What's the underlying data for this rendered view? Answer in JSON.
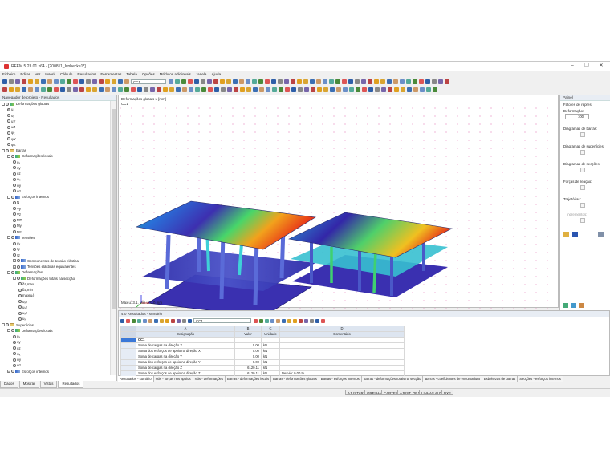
{
  "window": {
    "title": "RFEM 5.23.01 x64 - [200811_Ivobecke1*]",
    "controls": [
      "–",
      "❐",
      "✕"
    ]
  },
  "menu": [
    "Ficheiro",
    "Editar",
    "Ver",
    "Inserir",
    "Cálculo",
    "Resultados",
    "Ferramentas",
    "Tabela",
    "Opções",
    "Módulos adicionais",
    "Janela",
    "Ajuda"
  ],
  "toolbar": {
    "load_case": "CC1",
    "combo2": "",
    "icon_colors": [
      "#2e5fa8",
      "#d9a531",
      "#4a8a3a",
      "#b44",
      "#6b8fc8",
      "#888",
      "#3c6fb3",
      "#d55",
      "#e0a020",
      "#5a9",
      "#7766aa",
      "#c96"
    ]
  },
  "navigator": {
    "title": "Navegador de projeto - Resultados",
    "items": [
      {
        "level": 0,
        "exp": "-",
        "type": "check",
        "icon": "grn",
        "label": "Deformações globais"
      },
      {
        "level": 1,
        "type": "radio",
        "selected": true,
        "label": "u"
      },
      {
        "level": 1,
        "type": "radio",
        "label": "uₓ"
      },
      {
        "level": 1,
        "type": "radio",
        "label": "uY"
      },
      {
        "level": 1,
        "type": "radio",
        "label": "uZ"
      },
      {
        "level": 1,
        "type": "radio",
        "label": "φₓ"
      },
      {
        "level": 1,
        "type": "radio",
        "label": "φY"
      },
      {
        "level": 1,
        "type": "radio",
        "label": "φZ"
      },
      {
        "level": 0,
        "exp": "-",
        "type": "check",
        "icon": "fld",
        "label": "Barras"
      },
      {
        "level": 1,
        "exp": "-",
        "type": "check",
        "icon": "grn",
        "label": "Deformações locais"
      },
      {
        "level": 2,
        "type": "radio",
        "label": "uₓ"
      },
      {
        "level": 2,
        "type": "radio",
        "label": "uy"
      },
      {
        "level": 2,
        "type": "radio",
        "label": "uz"
      },
      {
        "level": 2,
        "type": "radio",
        "label": "φₓ"
      },
      {
        "level": 2,
        "type": "radio",
        "label": "φy"
      },
      {
        "level": 2,
        "type": "radio",
        "label": "φz"
      },
      {
        "level": 1,
        "exp": "-",
        "type": "check",
        "icon": "blu",
        "label": "Esforços internos"
      },
      {
        "level": 2,
        "type": "radio",
        "label": "N"
      },
      {
        "level": 2,
        "type": "radio",
        "label": "Vy"
      },
      {
        "level": 2,
        "type": "radio",
        "label": "Vz"
      },
      {
        "level": 2,
        "type": "radio",
        "label": "MT"
      },
      {
        "level": 2,
        "type": "radio",
        "label": "My"
      },
      {
        "level": 2,
        "type": "radio",
        "label": "Mz"
      },
      {
        "level": 1,
        "exp": "-",
        "type": "check",
        "icon": "blu",
        "label": "Tensões"
      },
      {
        "level": 2,
        "type": "radio",
        "label": "σₓ"
      },
      {
        "level": 2,
        "type": "radio",
        "label": "τy"
      },
      {
        "level": 2,
        "type": "radio",
        "label": "τz"
      },
      {
        "level": 2,
        "exp": "+",
        "type": "check",
        "icon": "blu",
        "label": "Componentes de tensão elástica"
      },
      {
        "level": 2,
        "exp": "+",
        "type": "check",
        "icon": "blu",
        "label": "Tensões elásticas equivalentes"
      },
      {
        "level": 1,
        "exp": "-",
        "type": "check",
        "icon": "grn",
        "label": "Deformações"
      },
      {
        "level": 2,
        "exp": "-",
        "type": "check",
        "icon": "grn",
        "label": "Deformações totais na secção"
      },
      {
        "level": 3,
        "type": "radio",
        "label": "δz,max"
      },
      {
        "level": 3,
        "type": "radio",
        "label": "δz,min"
      },
      {
        "level": 3,
        "type": "radio",
        "label": "max(uᵢ)"
      },
      {
        "level": 3,
        "type": "radio",
        "label": "uₓy"
      },
      {
        "level": 3,
        "type": "radio",
        "label": "uₓz"
      },
      {
        "level": 3,
        "type": "radio",
        "label": "uₓz"
      },
      {
        "level": 3,
        "type": "radio",
        "label": "uₓ"
      },
      {
        "level": 0,
        "exp": "-",
        "type": "check",
        "icon": "fld",
        "label": "Superfícies"
      },
      {
        "level": 1,
        "exp": "-",
        "type": "check",
        "icon": "grn",
        "label": "Deformações locais"
      },
      {
        "level": 2,
        "type": "radio",
        "label": "uₓ"
      },
      {
        "level": 2,
        "type": "radio",
        "selected": true,
        "label": "uy"
      },
      {
        "level": 2,
        "type": "radio",
        "label": "uz"
      },
      {
        "level": 2,
        "type": "radio",
        "label": "φₓ"
      },
      {
        "level": 2,
        "type": "radio",
        "label": "φy"
      },
      {
        "level": 2,
        "type": "radio",
        "label": "φz"
      },
      {
        "level": 1,
        "exp": "+",
        "type": "check",
        "icon": "blu",
        "label": "Esforços internos"
      },
      {
        "level": 1,
        "exp": "+",
        "type": "check",
        "icon": "blu",
        "label": "Esforços internos de barra"
      }
    ],
    "tabs": [
      "Dados",
      "Mostrar",
      "Vistas",
      "Resultados"
    ]
  },
  "view": {
    "label1": "Deformações globais u [mm]",
    "label2": "CC1",
    "footer": "Máx u: 3.1, Mín u: 0.0 mm"
  },
  "panel": {
    "title": "Painel",
    "factors_label": "Fatores de repres.",
    "deform_label": "Deformação:",
    "deform_value": "100",
    "bars_label": "Diagramas de barras:",
    "surf_label": "Diagramas de superfícies:",
    "sect_label": "Diagramas de secções:",
    "react_label": "Forças de reação:",
    "traj_label": "Trajetórias:",
    "incr_label": "Incrementos:"
  },
  "results": {
    "title": "4.0 Resultados - sumário",
    "load_case": "CC1",
    "col_letters": [
      "A",
      "B",
      "C",
      "D"
    ],
    "headers": [
      "Designação",
      "Valor",
      "Unidade",
      "Comentário"
    ],
    "group": "CC1",
    "rows": [
      {
        "name": "Soma de cargas na direção X",
        "value": "0.00",
        "unit": "kN",
        "comment": ""
      },
      {
        "name": "Soma dos esforços de apoio na direção X",
        "value": "0.00",
        "unit": "kN",
        "comment": ""
      },
      {
        "name": "Soma de cargas na direção Y",
        "value": "0.00",
        "unit": "kN",
        "comment": ""
      },
      {
        "name": "Soma dos esforços de apoio na direção Y",
        "value": "0.00",
        "unit": "kN",
        "comment": ""
      },
      {
        "name": "Soma de cargas na direção Z",
        "value": "6120.11",
        "unit": "kN",
        "comment": ""
      },
      {
        "name": "Soma dos esforços de apoio na direção Z",
        "value": "6120.11",
        "unit": "kN",
        "comment": "Desvio:  0.00 %"
      }
    ],
    "tabs": [
      "Resultados - sumário",
      "Nós - forças nos apoios",
      "Nós - deformações",
      "Barras - deformações locais",
      "Barras - deformações globais",
      "Barras - esforços internos",
      "Barras - deformações totais na secção",
      "Barras - coeficientes de encurvadura",
      "Esbeltezas de barras",
      "Secções - esforços internos"
    ]
  },
  "statusbar": [
    "AJUSTAR",
    "GRELHA",
    "CARTES",
    "AJUST. OBJ",
    "LINHAS AUX.",
    "DXF"
  ]
}
